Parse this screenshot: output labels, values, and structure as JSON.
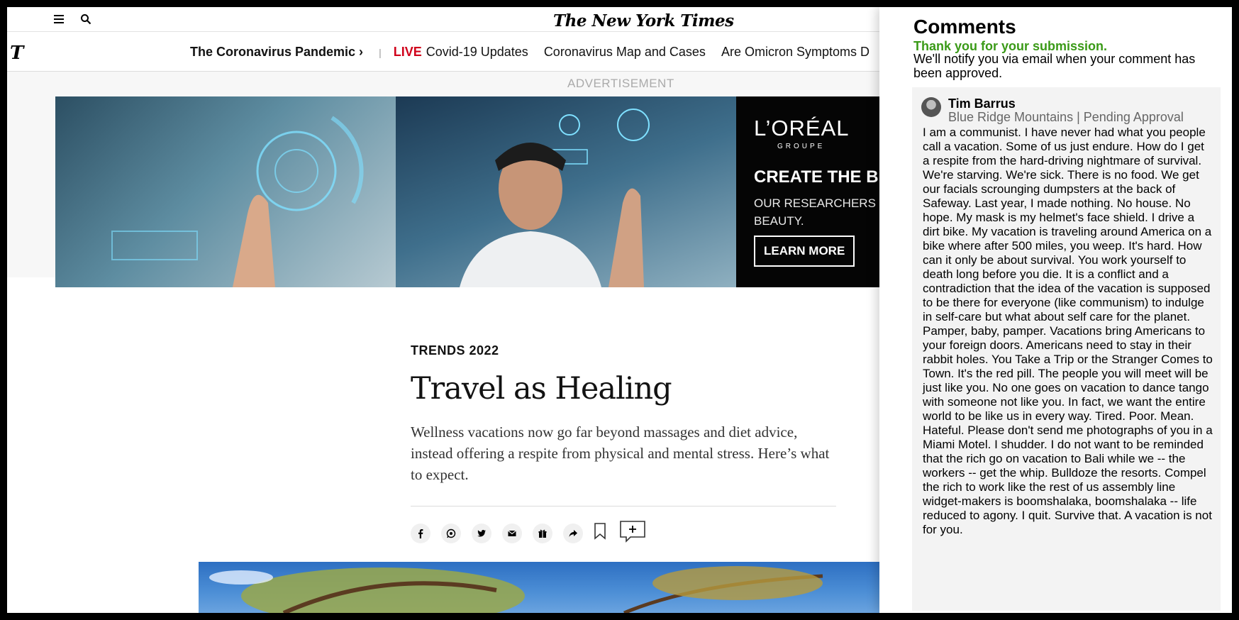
{
  "header": {
    "masthead": "The New York Times",
    "logo_glyph": "T"
  },
  "nav": {
    "items": [
      {
        "label": "The Coronavirus Pandemic ›"
      },
      {
        "live": "LIVE",
        "label": "Covid-19 Updates"
      },
      {
        "label": "Coronavirus Map and Cases"
      },
      {
        "label": "Are Omicron Symptoms D"
      }
    ]
  },
  "ad": {
    "label": "ADVERTISEMENT",
    "brand": "L’ORÉAL",
    "brand_sub": "GROUPE",
    "headline": "CREATE THE BE",
    "sub": "OUR RESEARCHERS S OF BEAUTY.",
    "cta": "LEARN MORE"
  },
  "article": {
    "kicker": "TRENDS 2022",
    "headline": "Travel as Healing",
    "dek": "Wellness vacations now go far beyond massages and diet advice, instead offering a respite from physical and mental stress. Here’s what to expect."
  },
  "comments": {
    "title": "Comments",
    "thanks": "Thank you for your submission.",
    "notify": "We'll notify you via email when your comment has been approved.",
    "comment": {
      "author": "Tim Barrus",
      "meta": "Blue Ridge Mountains | Pending Approval",
      "body": "I am a communist. I have never had what you people call a vacation. Some of us just endure. How do I get a respite from the hard-driving nightmare of survival. We're starving. We're sick. There is no food. We get our facials scrounging dumpsters at the back of Safeway. Last year, I made nothing. No house. No hope. My mask is my helmet's face shield. I drive a dirt bike. My vacation is traveling around America on a bike where after 500 miles, you weep. It's hard. How can it only be about survival. You work yourself to death long before you die. It is a conflict and a contradiction that the idea of the vacation is supposed to be there for everyone (like communism) to indulge in self-care but what about self care for the planet. Pamper, baby, pamper. Vacations bring Americans to your foreign doors. Americans need to stay in their rabbit holes. You Take a Trip or the Stranger Comes to Town. It's the red pill. The people you will meet will be just like you. No one goes on vacation to dance tango with someone not like you. In fact, we want the entire world to be like us in every way. Tired. Poor. Mean. Hateful. Please don't send me photographs of you in a Miami Motel. I shudder. I do not want to be reminded that the rich go on vacation to Bali while we -- the workers -- get the whip. Bulldoze the resorts. Compel the rich to work like the rest of us assembly line widget-makers is boomshalaka, boomshalaka -- life reduced to agony. I quit. Survive that. A vacation is not for you."
    }
  },
  "colors": {
    "live_red": "#d0021b",
    "thanks_green": "#3a9a17",
    "drawer_card_bg": "#f3f3f3"
  }
}
